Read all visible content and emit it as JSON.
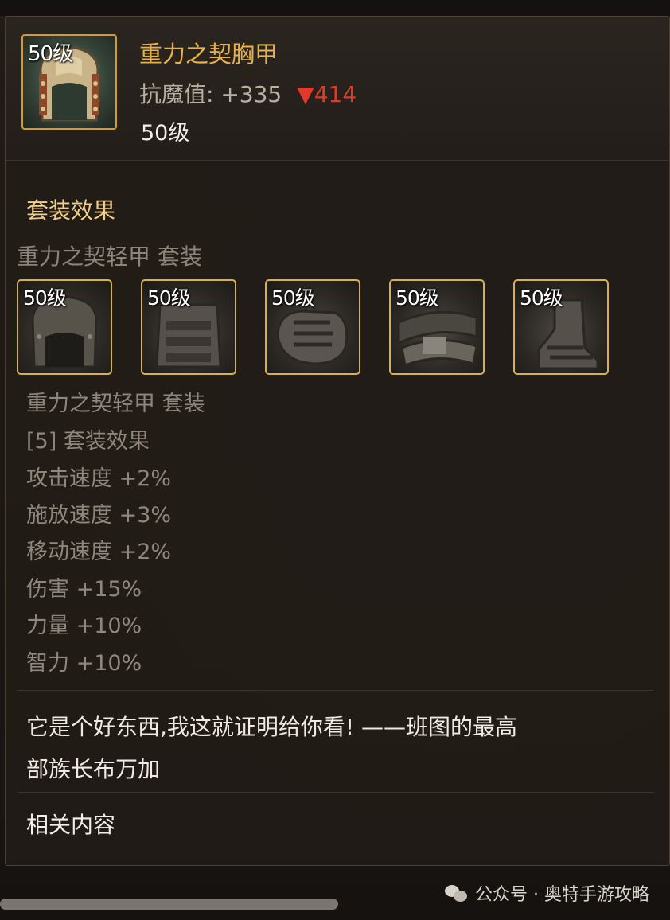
{
  "item": {
    "level_badge": "50级",
    "name": "重力之契胸甲",
    "stat_label": "抗魔值:",
    "stat_value": "+335",
    "stat_compare": "▼414",
    "level_text": "50级"
  },
  "set_section": {
    "title": "套装效果",
    "set_name": "重力之契轻甲 套装",
    "pieces": [
      {
        "level": "50级",
        "icon": "helmet-piece-icon"
      },
      {
        "level": "50级",
        "icon": "chest-piece-icon"
      },
      {
        "level": "50级",
        "icon": "gauntlet-piece-icon"
      },
      {
        "level": "50级",
        "icon": "belt-piece-icon"
      },
      {
        "level": "50级",
        "icon": "boots-piece-icon"
      }
    ],
    "effects_header": "重力之契轻甲 套装",
    "bonus_label": "[5] 套装效果",
    "bonuses": [
      "攻击速度 +2%",
      "施放速度 +3%",
      "移动速度 +2%",
      "伤害 +15%",
      "力量 +10%",
      "智力 +10%"
    ]
  },
  "flavor": {
    "line1": "它是个好东西,我这就证明给你看! ——班图的最高",
    "line2": "部族长布万加"
  },
  "related": {
    "title": "相关内容"
  },
  "watermark": {
    "text": "公众号 · 奥特手游攻略",
    "icon": "wechat-icon"
  },
  "colors": {
    "item_name": "#e8b24a",
    "section_title": "#f1cf8a",
    "compare_down": "#e23a2a",
    "icon_border": "#d39a2c",
    "piece_border": "#d6b24a"
  }
}
